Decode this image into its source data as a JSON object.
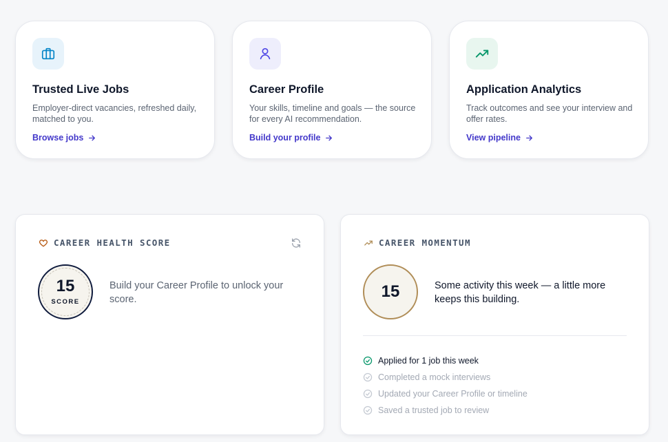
{
  "features": [
    {
      "title": "Trusted Live Jobs",
      "description": "Employer-direct vacancies, refreshed daily, matched to you.",
      "link": "Browse jobs",
      "icon": "briefcase-icon",
      "accent": "#0284c7",
      "icon_bg": "#e7f3fb"
    },
    {
      "title": "Career Profile",
      "description": "Your skills, timeline and goals — the source for every AI recommendation.",
      "link": "Build your profile",
      "icon": "user-icon",
      "accent": "#4f46e5",
      "icon_bg": "#eeeefc"
    },
    {
      "title": "Application Analytics",
      "description": "Track outcomes and see your interview and offer rates.",
      "link": "View pipeline",
      "icon": "trending-up-icon",
      "accent": "#059669",
      "icon_bg": "#e8f6ef"
    }
  ],
  "health": {
    "title": "CAREER HEALTH SCORE",
    "score": "15",
    "score_label": "SCORE",
    "message": "Build your Career Profile to unlock your score."
  },
  "momentum": {
    "title": "CAREER MOMENTUM",
    "score": "15",
    "message": "Some activity this week — a little more keeps this building.",
    "checklist": [
      {
        "text": "Applied for 1 job this week",
        "done": true
      },
      {
        "text": "Completed a mock interviews",
        "done": false
      },
      {
        "text": "Updated your Career Profile or timeline",
        "done": false
      },
      {
        "text": "Saved a trusted job to review",
        "done": false
      }
    ]
  },
  "colors": {
    "link": "#4338ca",
    "health_accent": "#b45309",
    "momentum_accent": "#b08d57",
    "check_done": "#059669",
    "check_todo": "#c4c9d2"
  }
}
